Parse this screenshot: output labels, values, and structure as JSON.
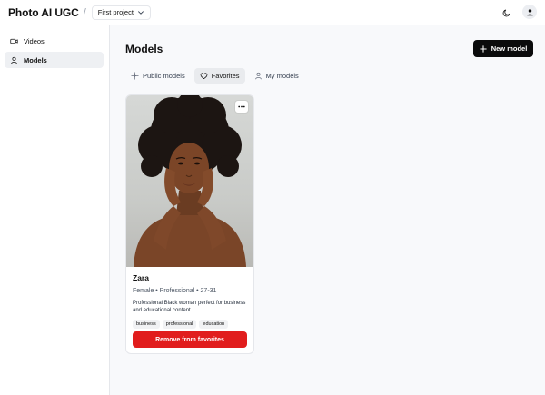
{
  "header": {
    "brand": "Photo AI UGC",
    "separator": "/",
    "project": {
      "label": "First project",
      "icon": "chevron-down-icon"
    },
    "icons": [
      "moon-icon",
      "user-icon"
    ]
  },
  "sidebar": {
    "items": [
      {
        "label": "Videos",
        "icon": "video-icon",
        "active": false
      },
      {
        "label": "Models",
        "icon": "user-icon",
        "active": true
      }
    ]
  },
  "main": {
    "title": "Models",
    "new_button": {
      "label": "New model",
      "icon": "plus-icon"
    },
    "tabs": [
      {
        "label": "Public models",
        "icon": "sparkle-icon",
        "active": false
      },
      {
        "label": "Favorites",
        "icon": "heart-icon",
        "active": true
      },
      {
        "label": "My models",
        "icon": "user-icon",
        "active": false
      }
    ],
    "models": [
      {
        "name": "Zara",
        "meta": "Female • Professional • 27-31",
        "description": "Professional Black woman perfect for business and educational content",
        "tags": [
          "business",
          "professional",
          "education"
        ],
        "action": "Remove from favorites"
      }
    ]
  },
  "colors": {
    "accent": "#0b0b0c",
    "danger": "#e11d1d",
    "background": "#f8f9fb"
  }
}
